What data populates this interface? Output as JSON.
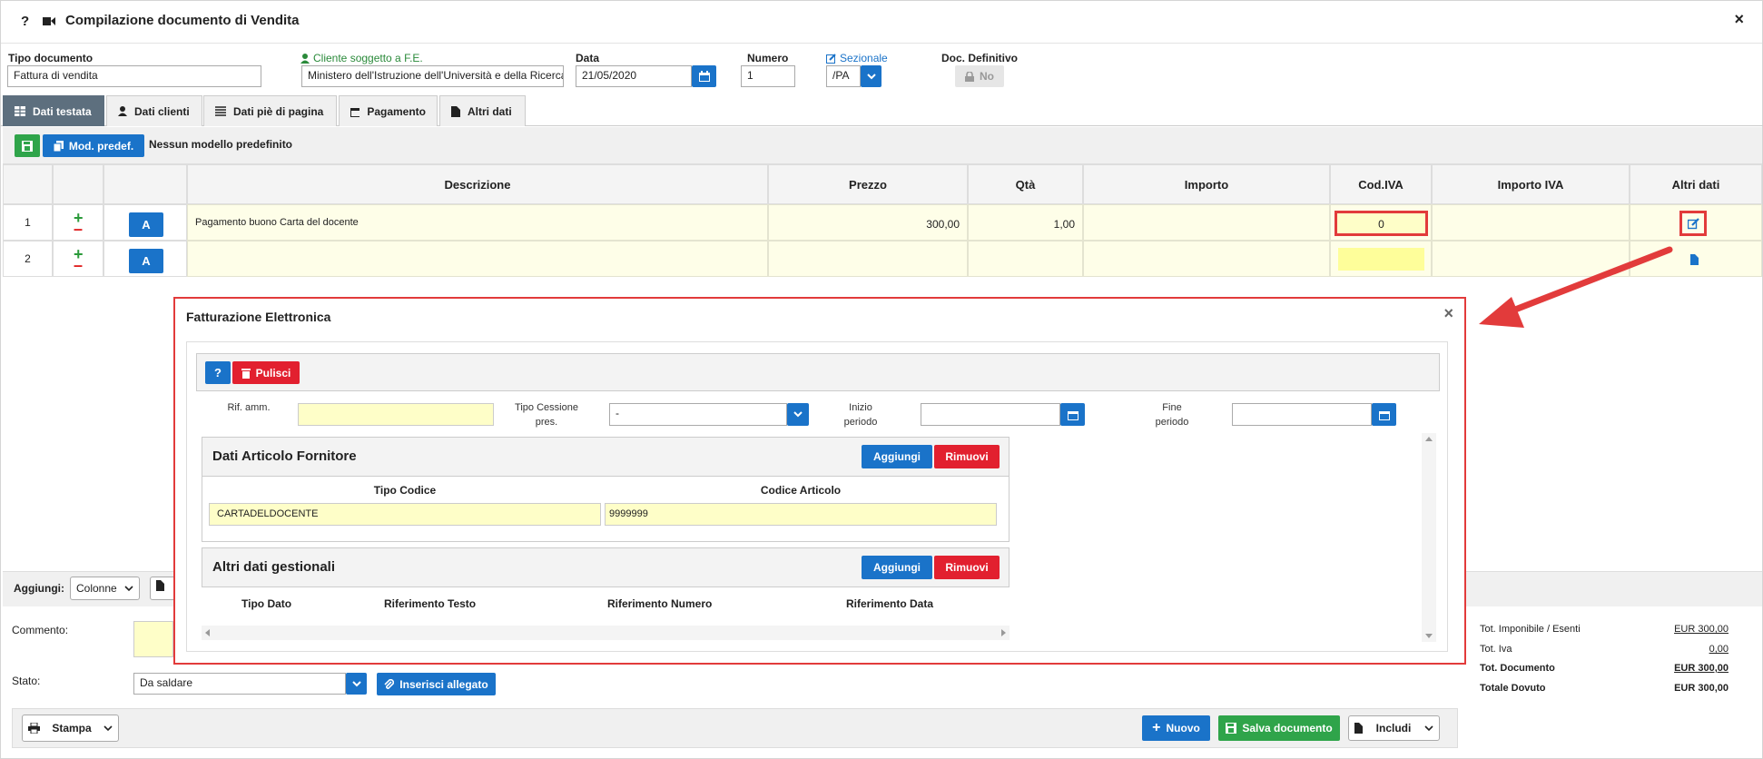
{
  "window": {
    "title": "Compilazione documento di Vendita",
    "help": "?",
    "close": "×"
  },
  "header": {
    "tipo_documento": {
      "label": "Tipo documento",
      "value": "Fattura di vendita"
    },
    "cliente": {
      "label": "Cliente soggetto a F.E.",
      "value": "Ministero dell'Istruzione dell'Università e della Ricerca"
    },
    "data": {
      "label": "Data",
      "value": "21/05/2020"
    },
    "numero": {
      "label": "Numero",
      "value": "1"
    },
    "sezionale": {
      "label": "Sezionale",
      "value": "/PA"
    },
    "doc_definitivo": {
      "label": "Doc. Definitivo",
      "value": "No"
    }
  },
  "tabs": [
    "Dati testata",
    "Dati clienti",
    "Dati piè di pagina",
    "Pagamento",
    "Altri dati"
  ],
  "toolbar": {
    "mod_predef": "Mod. predef.",
    "nessun_modello": "Nessun modello predefinito"
  },
  "table": {
    "columns": [
      "Descrizione",
      "Prezzo",
      "Qtà",
      "Importo",
      "Cod.IVA",
      "Importo IVA",
      "Altri dati"
    ],
    "rows": [
      {
        "num": "1",
        "btn": "A",
        "descrizione": "Pagamento buono Carta del docente",
        "prezzo": "300,00",
        "qta": "1,00",
        "cod_iva": "0"
      },
      {
        "num": "2",
        "btn": "A",
        "descrizione": "",
        "prezzo": "",
        "qta": "",
        "cod_iva": ""
      }
    ]
  },
  "bottom": {
    "aggiungi": "Aggiungi:",
    "colonne": "Colonne",
    "commento": "Commento:",
    "stato_label": "Stato:",
    "stato_value": "Da saldare",
    "inserisci_allegato": "Inserisci allegato",
    "stampa": "Stampa",
    "nuovo": "Nuovo",
    "salva": "Salva documento",
    "includi": "Includi"
  },
  "totals": [
    {
      "label": "Tot. Imponibile / Esenti",
      "value": "EUR 300,00"
    },
    {
      "label": "Tot. Iva",
      "value": "0,00"
    },
    {
      "label": "Tot. Documento",
      "value": "EUR 300,00"
    },
    {
      "label": "Totale Dovuto",
      "value": "EUR 300,00"
    }
  ],
  "modal": {
    "title": "Fatturazione Elettronica",
    "close": "×",
    "help": "?",
    "pulisci": "Pulisci",
    "rif_amm": "Rif. amm.",
    "tipo_cessione": "Tipo Cessione pres.",
    "tipo_cessione_value": "-",
    "inizio_periodo": "Inizio periodo",
    "fine_periodo": "Fine periodo",
    "sec1_title": "Dati Articolo Fornitore",
    "aggiungi": "Aggiungi",
    "rimuovi": "Rimuovi",
    "tipo_codice": "Tipo Codice",
    "codice_articolo": "Codice Articolo",
    "tipo_codice_value": "CARTADELDOCENTE",
    "codice_articolo_value": "9999999",
    "sec2_title": "Altri dati gestionali",
    "cols2": [
      "Tipo Dato",
      "Riferimento Testo",
      "Riferimento Numero",
      "Riferimento Data"
    ]
  },
  "colors": {
    "accent": "#1a73c9",
    "green": "#2fa44a",
    "red": "#e2202f",
    "highlight": "#e23b3b",
    "yellow": "#fefec8"
  }
}
